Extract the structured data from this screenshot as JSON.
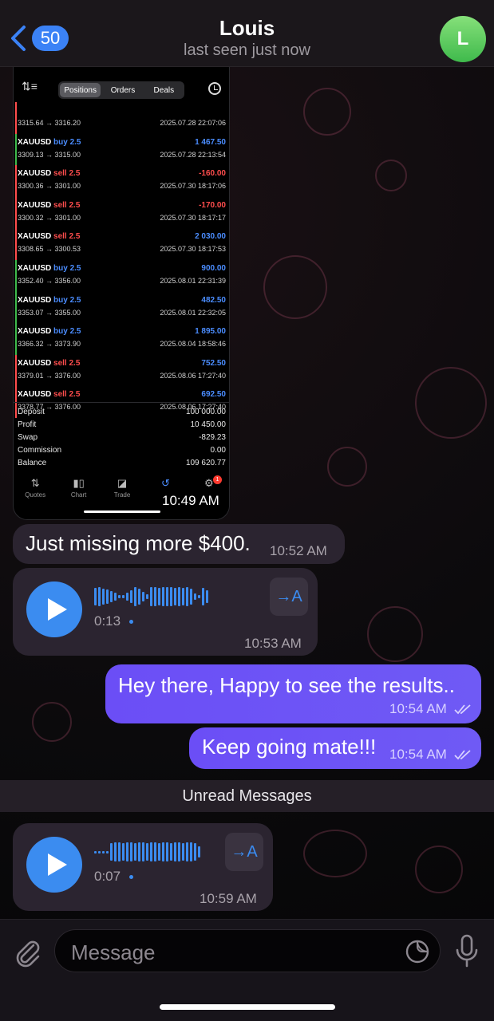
{
  "header": {
    "back_count": "50",
    "title": "Louis",
    "subtitle": "last seen just now",
    "avatar_letter": "L",
    "avatar_color": "#4cc35a"
  },
  "screenshot": {
    "tabs": [
      "Positions",
      "Orders",
      "Deals"
    ],
    "active_tab": "Positions",
    "trades": [
      {
        "symbol": "",
        "side": "",
        "pnl": "",
        "pnl_type": "",
        "prices": "3315.64 → 3316.20",
        "datetime": "2025.07.28 22:07:06"
      },
      {
        "symbol": "XAUUSD",
        "side": "buy 2.5",
        "pnl": "1 467.50",
        "pnl_type": "pos",
        "prices": "3309.13 → 3315.00",
        "datetime": "2025.07.28 22:13:54"
      },
      {
        "symbol": "XAUUSD",
        "side": "sell 2.5",
        "pnl": "-160.00",
        "pnl_type": "neg",
        "prices": "3300.36 → 3301.00",
        "datetime": "2025.07.30 18:17:06"
      },
      {
        "symbol": "XAUUSD",
        "side": "sell 2.5",
        "pnl": "-170.00",
        "pnl_type": "neg",
        "prices": "3300.32 → 3301.00",
        "datetime": "2025.07.30 18:17:17"
      },
      {
        "symbol": "XAUUSD",
        "side": "sell 2.5",
        "pnl": "2 030.00",
        "pnl_type": "pos",
        "prices": "3308.65 → 3300.53",
        "datetime": "2025.07.30 18:17:53"
      },
      {
        "symbol": "XAUUSD",
        "side": "buy 2.5",
        "pnl": "900.00",
        "pnl_type": "pos",
        "prices": "3352.40 → 3356.00",
        "datetime": "2025.08.01 22:31:39"
      },
      {
        "symbol": "XAUUSD",
        "side": "buy 2.5",
        "pnl": "482.50",
        "pnl_type": "pos",
        "prices": "3353.07 → 3355.00",
        "datetime": "2025.08.01 22:32:05"
      },
      {
        "symbol": "XAUUSD",
        "side": "buy 2.5",
        "pnl": "1 895.00",
        "pnl_type": "pos",
        "prices": "3366.32 → 3373.90",
        "datetime": "2025.08.04 18:58:46"
      },
      {
        "symbol": "XAUUSD",
        "side": "sell 2.5",
        "pnl": "752.50",
        "pnl_type": "pos",
        "prices": "3379.01 → 3376.00",
        "datetime": "2025.08.06 17:27:40"
      },
      {
        "symbol": "XAUUSD",
        "side": "sell 2.5",
        "pnl": "692.50",
        "pnl_type": "pos",
        "prices": "3378.77 → 3376.00",
        "datetime": "2025.08.06 17:27:40"
      }
    ],
    "summary": [
      {
        "label": "Deposit",
        "value": "100 000.00"
      },
      {
        "label": "Profit",
        "value": "10 450.00"
      },
      {
        "label": "Swap",
        "value": "-829.23"
      },
      {
        "label": "Commission",
        "value": "0.00"
      },
      {
        "label": "Balance",
        "value": "109 620.77"
      }
    ],
    "nav": [
      "Quotes",
      "Chart",
      "Trade",
      "History",
      "Settings"
    ],
    "nav_badge": "1",
    "time": "10:49 AM"
  },
  "messages": {
    "m1": {
      "text": "Just missing more $400.",
      "time": "10:52 AM"
    },
    "voice1": {
      "duration": "0:13",
      "time": "10:53 AM",
      "translate": "→A"
    },
    "m2": {
      "text": "Hey there, Happy to see the results..",
      "time": "10:54 AM"
    },
    "m3": {
      "text": "Keep going mate!!!",
      "time": "10:54 AM"
    },
    "unread": "Unread Messages",
    "voice2": {
      "duration": "0:07",
      "time": "10:59 AM",
      "translate": "→A"
    }
  },
  "input": {
    "placeholder": "Message"
  },
  "colors": {
    "accent": "#3b8cf0",
    "outgoing_bubble": "#6b4ef6",
    "incoming_bubble": "#2b2430",
    "buy": "#4b8dff",
    "sell": "#ff4d4d"
  },
  "icons": [
    "back-chevron-icon",
    "attach-icon",
    "sticker-icon",
    "mic-icon",
    "play-icon",
    "translate-icon",
    "read-ticks-icon"
  ]
}
